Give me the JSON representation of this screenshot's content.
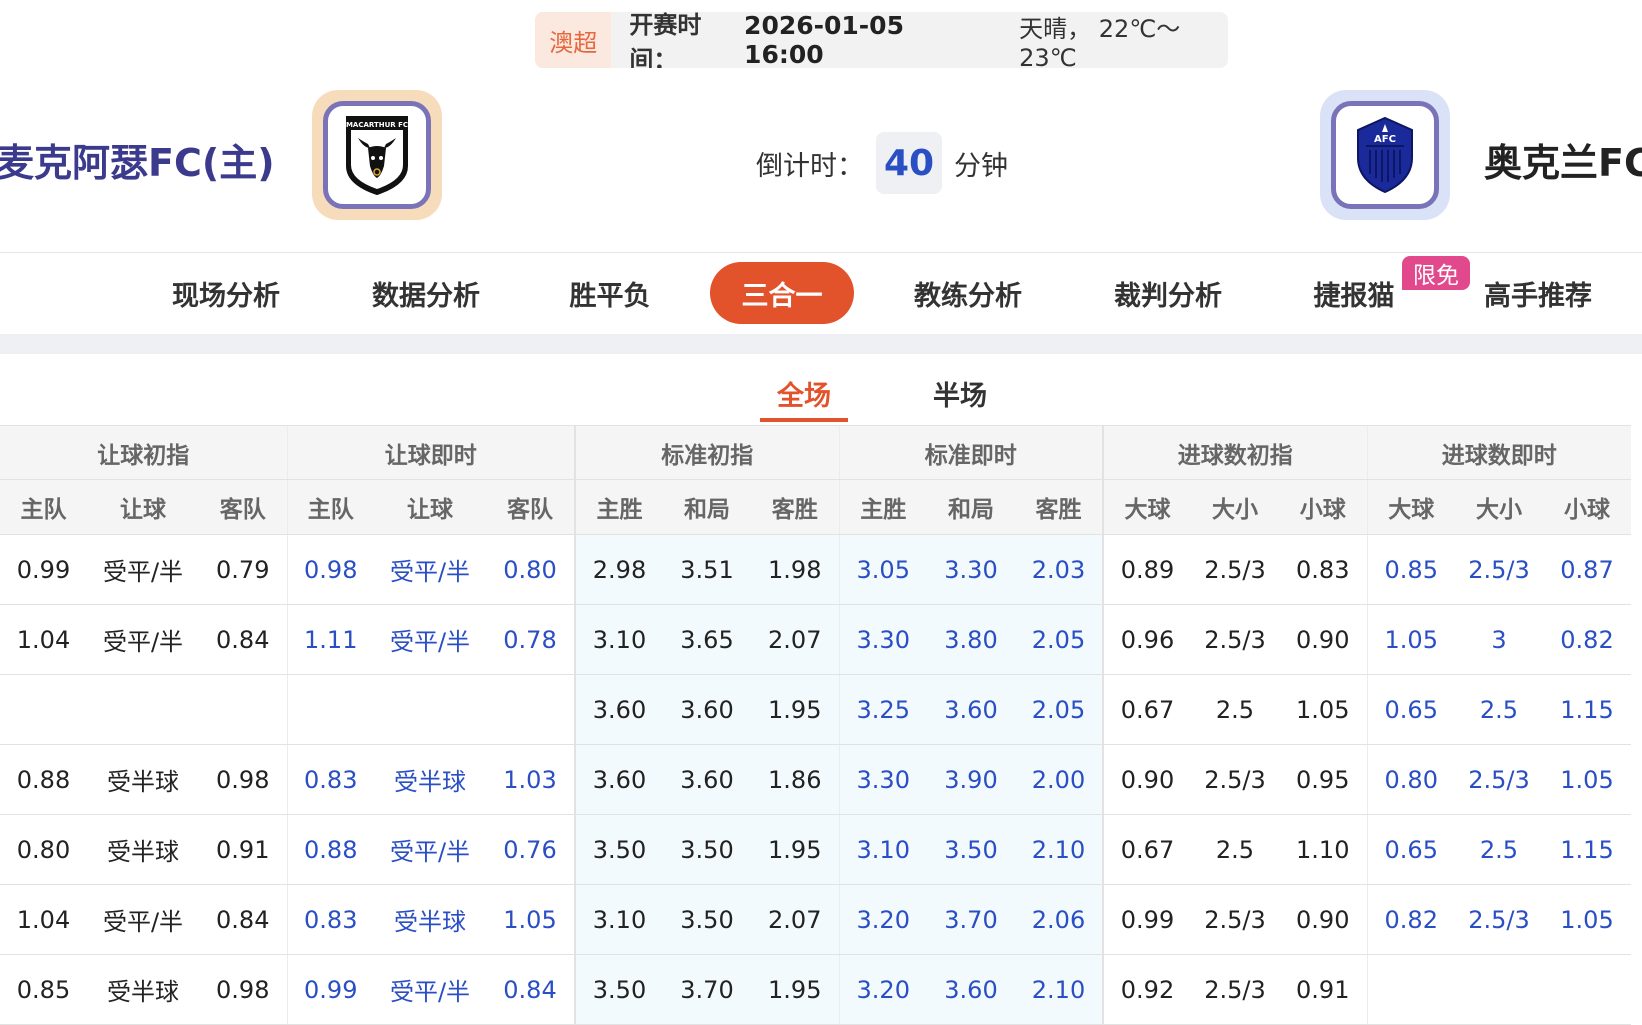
{
  "match": {
    "league": "澳超",
    "time_label": "开赛时间：",
    "time_value": "2026-01-05 16:00",
    "weather": "天晴， 22℃～23℃"
  },
  "home": {
    "name": "麦克阿瑟FC(主)",
    "logo_text": "MACARTHUR FC"
  },
  "away": {
    "name": "奥克兰FC",
    "logo_text": "AFC"
  },
  "countdown": {
    "label": "倒计时：",
    "value": "40",
    "unit": "分钟"
  },
  "nav": {
    "items": [
      "现场分析",
      "数据分析",
      "胜平负",
      "三合一",
      "教练分析",
      "裁判分析",
      "捷报猫",
      "高手推荐"
    ],
    "active": "三合一",
    "badge": "限免"
  },
  "subtabs": {
    "full": "全场",
    "half": "半场"
  },
  "table": {
    "groups": [
      "让球初指",
      "让球即时",
      "标准初指",
      "标准即时",
      "进球数初指",
      "进球数即时"
    ],
    "subheaders": [
      "主队",
      "让球",
      "客队",
      "主队",
      "让球",
      "客队",
      "主胜",
      "和局",
      "客胜",
      "主胜",
      "和局",
      "客胜",
      "大球",
      "大小",
      "小球",
      "大球",
      "大小",
      "小球"
    ],
    "rows": [
      [
        "0.99",
        "受平/半",
        "0.79",
        "0.98",
        "受平/半",
        "0.80",
        "2.98",
        "3.51",
        "1.98",
        "3.05",
        "3.30",
        "2.03",
        "0.89",
        "2.5/3",
        "0.83",
        "0.85",
        "2.5/3",
        "0.87"
      ],
      [
        "1.04",
        "受平/半",
        "0.84",
        "1.11",
        "受平/半",
        "0.78",
        "3.10",
        "3.65",
        "2.07",
        "3.30",
        "3.80",
        "2.05",
        "0.96",
        "2.5/3",
        "0.90",
        "1.05",
        "3",
        "0.82"
      ],
      [
        "",
        "",
        "",
        "",
        "",
        "",
        "3.60",
        "3.60",
        "1.95",
        "3.25",
        "3.60",
        "2.05",
        "0.67",
        "2.5",
        "1.05",
        "0.65",
        "2.5",
        "1.15"
      ],
      [
        "0.88",
        "受半球",
        "0.98",
        "0.83",
        "受半球",
        "1.03",
        "3.60",
        "3.60",
        "1.86",
        "3.30",
        "3.90",
        "2.00",
        "0.90",
        "2.5/3",
        "0.95",
        "0.80",
        "2.5/3",
        "1.05"
      ],
      [
        "0.80",
        "受半球",
        "0.91",
        "0.88",
        "受平/半",
        "0.76",
        "3.50",
        "3.50",
        "1.95",
        "3.10",
        "3.50",
        "2.10",
        "0.67",
        "2.5",
        "1.10",
        "0.65",
        "2.5",
        "1.15"
      ],
      [
        "1.04",
        "受平/半",
        "0.84",
        "0.83",
        "受半球",
        "1.05",
        "3.10",
        "3.50",
        "2.07",
        "3.20",
        "3.70",
        "2.06",
        "0.99",
        "2.5/3",
        "0.90",
        "0.82",
        "2.5/3",
        "1.05"
      ],
      [
        "0.85",
        "受半球",
        "0.98",
        "0.99",
        "受平/半",
        "0.84",
        "3.50",
        "3.70",
        "1.95",
        "3.20",
        "3.60",
        "2.10",
        "0.92",
        "2.5/3",
        "0.91",
        "",
        "",
        ""
      ]
    ]
  },
  "colors": {
    "accent": "#e2532b",
    "badge": "#e2488c",
    "link": "#2a4ec4",
    "home_name": "#3b3a8c"
  }
}
